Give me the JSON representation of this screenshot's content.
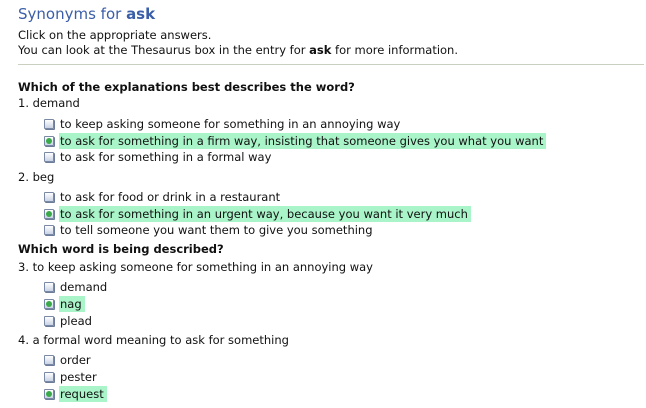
{
  "header": {
    "title_prefix": "Synonyms for ",
    "title_word": "ask",
    "instruction": "Click on the appropriate answers.",
    "info_prefix": "You can look at the Thesaurus box in the entry for ",
    "info_word": "ask",
    "info_suffix": " for more information."
  },
  "sections": [
    {
      "heading": "Which of the explanations best describes the word?"
    },
    {
      "heading": "Which word is being described?"
    }
  ],
  "questions": [
    {
      "prompt": "1. demand",
      "options": [
        {
          "label": "to keep asking someone for something in an annoying way",
          "checked": false,
          "correct": false
        },
        {
          "label": "to ask for something in a firm way, insisting that someone gives you what you want",
          "checked": true,
          "correct": true
        },
        {
          "label": "to ask for something in a formal way",
          "checked": false,
          "correct": false
        }
      ]
    },
    {
      "prompt": "2. beg",
      "options": [
        {
          "label": "to ask for food or drink in a restaurant",
          "checked": false,
          "correct": false
        },
        {
          "label": "to ask for something in an urgent way, because you want it very much",
          "checked": true,
          "correct": true
        },
        {
          "label": "to tell someone you want them to give you something",
          "checked": false,
          "correct": false
        }
      ]
    },
    {
      "prompt": "3. to keep asking someone for something in an annoying way",
      "options": [
        {
          "label": "demand",
          "checked": false,
          "correct": false
        },
        {
          "label": "nag",
          "checked": true,
          "correct": true
        },
        {
          "label": "plead",
          "checked": false,
          "correct": false
        }
      ]
    },
    {
      "prompt": "4. a formal word meaning to ask for something",
      "options": [
        {
          "label": "order",
          "checked": false,
          "correct": false
        },
        {
          "label": "pester",
          "checked": false,
          "correct": false
        },
        {
          "label": "request",
          "checked": true,
          "correct": true
        }
      ]
    }
  ],
  "colors": {
    "title": "#3b5ea8",
    "correct_highlight": "#a9f4c8",
    "check_dot": "#3aa94a",
    "divider": "#c9d0c0"
  },
  "icons": {
    "unchecked": "checkbox-unchecked-icon",
    "checked": "checkbox-checked-icon"
  }
}
